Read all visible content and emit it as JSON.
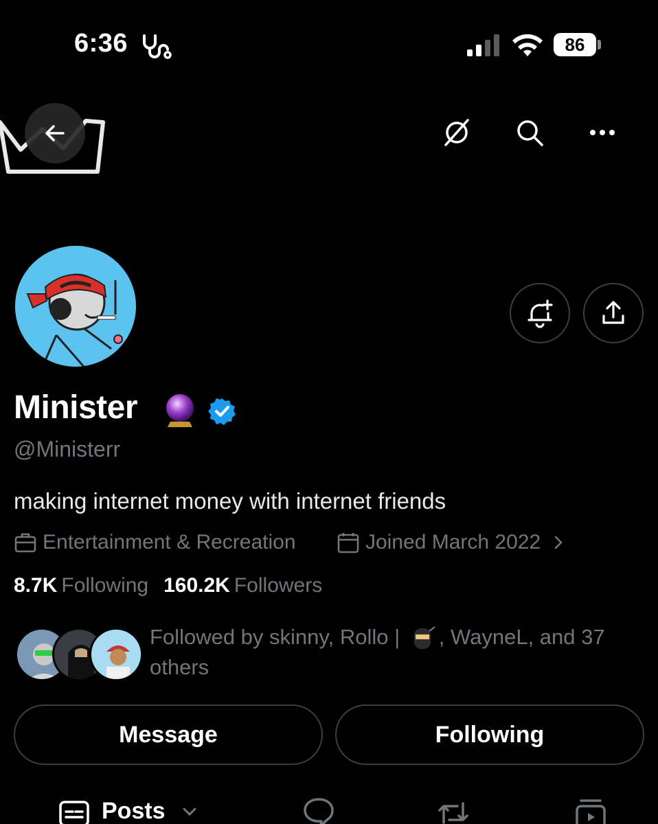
{
  "status_bar": {
    "time": "6:36",
    "battery": "86"
  },
  "profile": {
    "display_name": "Minister",
    "handle": "@Ministerr",
    "bio": "making internet money with internet friends",
    "category": "Entertainment & Recreation",
    "joined": "Joined March 2022",
    "following_count": "8.7K",
    "following_label": "Following",
    "followers_count": "160.2K",
    "followers_label": "Followers",
    "followed_by_prefix": "Followed by skinny, Rollo |",
    "followed_by_suffix": ", WayneL, and 37 others",
    "verified_color": "#1d9bf0"
  },
  "actions": {
    "message_label": "Message",
    "following_label": "Following"
  },
  "tabs": {
    "posts_label": "Posts"
  },
  "colors": {
    "background": "#000000",
    "muted_text": "#71767b",
    "border": "#3a3f44",
    "avatar_bg": "#5cc3ee"
  }
}
